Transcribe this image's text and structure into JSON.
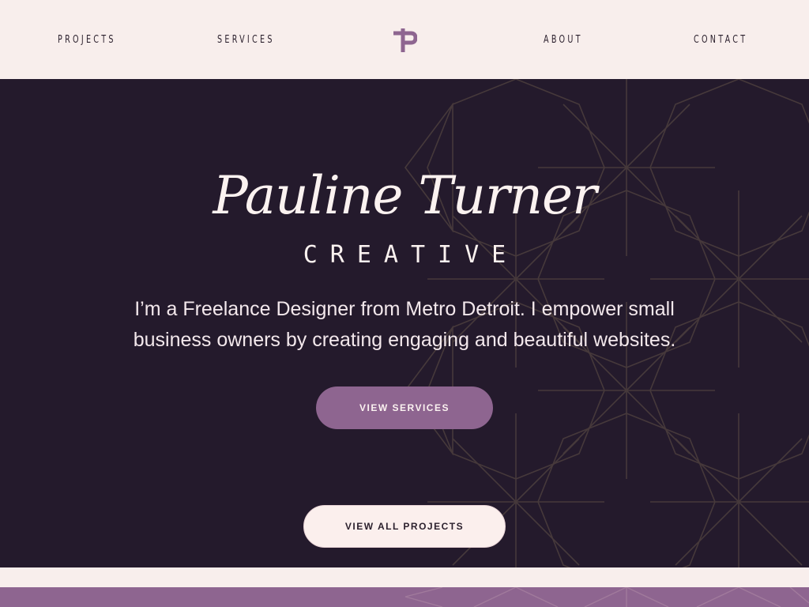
{
  "nav": {
    "items": [
      {
        "label": "PROJECTS"
      },
      {
        "label": "SERVICES"
      },
      {
        "label": "ABOUT"
      },
      {
        "label": "CONTACT"
      }
    ],
    "logo_icon": "p-monogram-icon"
  },
  "hero": {
    "name": "Pauline Turner",
    "subtitle": "CREATIVE",
    "description": "I’m a Freelance Designer from Metro Detroit. I empower small business owners by creating engaging and beautiful websites.",
    "primary_button": "VIEW SERVICES",
    "secondary_button": "VIEW ALL PROJECTS"
  },
  "colors": {
    "background_light": "#f8eeec",
    "hero_dark": "#241a2c",
    "accent_purple": "#8e6590",
    "text_dark": "#2a1f2c",
    "text_light": "#fbf2f0"
  }
}
